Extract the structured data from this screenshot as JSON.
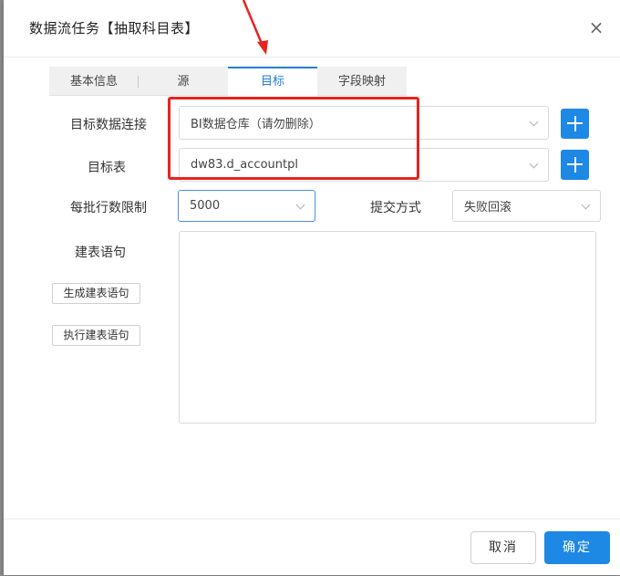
{
  "dialog": {
    "title": "数据流任务【抽取科目表】",
    "close_glyph": "×"
  },
  "tabs": [
    {
      "label": "基本信息"
    },
    {
      "label": "源"
    },
    {
      "label": "目标",
      "active": true
    },
    {
      "label": "字段映射"
    }
  ],
  "form": {
    "target_connection": {
      "label": "目标数据连接",
      "value": "BI数据仓库（请勿删除）"
    },
    "target_table": {
      "label": "目标表",
      "value": "dw83.d_accountpl"
    },
    "batch_limit": {
      "label": "每批行数限制",
      "value": "5000"
    },
    "commit_mode": {
      "label": "提交方式",
      "value": "失败回滚"
    },
    "ddl": {
      "label": "建表语句",
      "value": ""
    },
    "generate_ddl_button": "生成建表语句",
    "execute_ddl_button": "执行建表语句"
  },
  "footer": {
    "cancel_label": "取消",
    "ok_label": "确定"
  },
  "colors": {
    "accent": "#1e88e5",
    "highlight_box": "#e8231f"
  },
  "icons": {
    "add_connection": "plus-icon",
    "add_table": "plus-icon",
    "dropdown": "chevron-down-icon",
    "close": "close-icon"
  }
}
